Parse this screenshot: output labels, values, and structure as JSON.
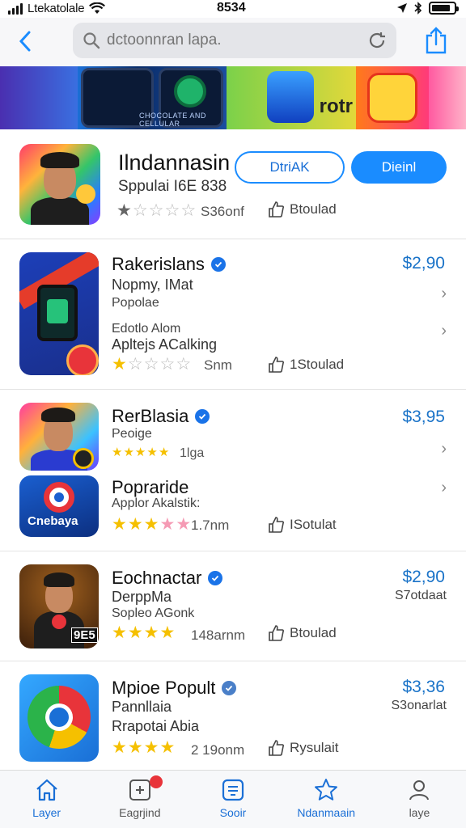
{
  "status_bar": {
    "carrier": "Ltekatolale",
    "time": "8534"
  },
  "nav": {
    "search_placeholder": "dctoonnran lapa."
  },
  "banner": {
    "caption": "CHOCOLATE AND CELLULAR",
    "text": "rotr"
  },
  "featured": {
    "title": "Ilndannasin",
    "subtitle": "Sppulai I6E 838",
    "button_outline": "DtriAK",
    "button_primary": "Dieinl",
    "rating_meta": "S36onf",
    "thumb_label": "Btoulad"
  },
  "list": [
    {
      "title": "Rakerislans",
      "price": "$2,90",
      "line1": "Nopmy, IMat",
      "line2": "Popolae",
      "line3": "Edotlo Alom",
      "line4": "Apltejs ACalking",
      "meta": "Snm",
      "thumb_label": "1Stoulad"
    },
    {
      "title": "RerBlasia",
      "price": "$3,95",
      "line1": "Peoige",
      "rating_meta": "1lga"
    },
    {
      "title": "Popraride",
      "line1": "Applor Akalstik:",
      "meta": "1.7nm",
      "thumb_label": "ISotulat",
      "icon_text": "Cnebaya"
    },
    {
      "title": "Eochnactar",
      "price": "$2,90",
      "right_note": "S7otdaat",
      "line1": "DerppMa",
      "line2": "Sopleo AGonk",
      "meta": "148arnm",
      "thumb_label": "Btoulad",
      "icon_text": "9E5"
    },
    {
      "title": "Mpioe Popult",
      "price": "$3,36",
      "right_note": "S3onarlat",
      "line1": "Pannllaia",
      "line2": "Rrapotai Abia",
      "meta": "2 19onm",
      "thumb_label": "Rysulait"
    }
  ],
  "tabs": [
    {
      "label": "Layer",
      "icon": "home-icon"
    },
    {
      "label": "Eagrjind",
      "icon": "games-icon"
    },
    {
      "label": "Sooir",
      "icon": "apps-icon"
    },
    {
      "label": "Ndanmaain",
      "icon": "star-icon"
    },
    {
      "label": "laye",
      "icon": "person-icon"
    }
  ],
  "colors": {
    "accent": "#1a8cff",
    "price": "#1a73c8",
    "star": "#f5c000",
    "notification": "#e8343a"
  }
}
